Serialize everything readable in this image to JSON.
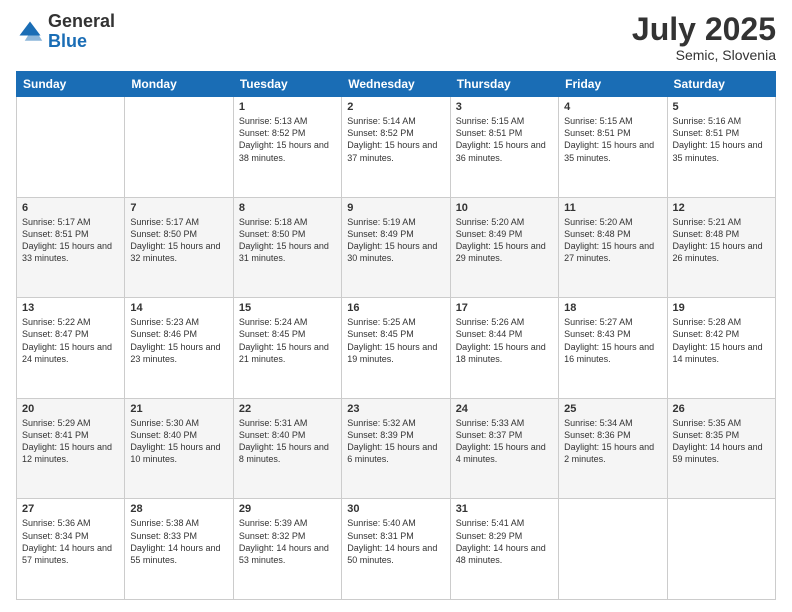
{
  "header": {
    "logo_general": "General",
    "logo_blue": "Blue",
    "title": "July 2025",
    "location": "Semic, Slovenia"
  },
  "days_of_week": [
    "Sunday",
    "Monday",
    "Tuesday",
    "Wednesday",
    "Thursday",
    "Friday",
    "Saturday"
  ],
  "weeks": [
    [
      {
        "day": "",
        "info": ""
      },
      {
        "day": "",
        "info": ""
      },
      {
        "day": "1",
        "info": "Sunrise: 5:13 AM\nSunset: 8:52 PM\nDaylight: 15 hours and 38 minutes."
      },
      {
        "day": "2",
        "info": "Sunrise: 5:14 AM\nSunset: 8:52 PM\nDaylight: 15 hours and 37 minutes."
      },
      {
        "day": "3",
        "info": "Sunrise: 5:15 AM\nSunset: 8:51 PM\nDaylight: 15 hours and 36 minutes."
      },
      {
        "day": "4",
        "info": "Sunrise: 5:15 AM\nSunset: 8:51 PM\nDaylight: 15 hours and 35 minutes."
      },
      {
        "day": "5",
        "info": "Sunrise: 5:16 AM\nSunset: 8:51 PM\nDaylight: 15 hours and 35 minutes."
      }
    ],
    [
      {
        "day": "6",
        "info": "Sunrise: 5:17 AM\nSunset: 8:51 PM\nDaylight: 15 hours and 33 minutes."
      },
      {
        "day": "7",
        "info": "Sunrise: 5:17 AM\nSunset: 8:50 PM\nDaylight: 15 hours and 32 minutes."
      },
      {
        "day": "8",
        "info": "Sunrise: 5:18 AM\nSunset: 8:50 PM\nDaylight: 15 hours and 31 minutes."
      },
      {
        "day": "9",
        "info": "Sunrise: 5:19 AM\nSunset: 8:49 PM\nDaylight: 15 hours and 30 minutes."
      },
      {
        "day": "10",
        "info": "Sunrise: 5:20 AM\nSunset: 8:49 PM\nDaylight: 15 hours and 29 minutes."
      },
      {
        "day": "11",
        "info": "Sunrise: 5:20 AM\nSunset: 8:48 PM\nDaylight: 15 hours and 27 minutes."
      },
      {
        "day": "12",
        "info": "Sunrise: 5:21 AM\nSunset: 8:48 PM\nDaylight: 15 hours and 26 minutes."
      }
    ],
    [
      {
        "day": "13",
        "info": "Sunrise: 5:22 AM\nSunset: 8:47 PM\nDaylight: 15 hours and 24 minutes."
      },
      {
        "day": "14",
        "info": "Sunrise: 5:23 AM\nSunset: 8:46 PM\nDaylight: 15 hours and 23 minutes."
      },
      {
        "day": "15",
        "info": "Sunrise: 5:24 AM\nSunset: 8:45 PM\nDaylight: 15 hours and 21 minutes."
      },
      {
        "day": "16",
        "info": "Sunrise: 5:25 AM\nSunset: 8:45 PM\nDaylight: 15 hours and 19 minutes."
      },
      {
        "day": "17",
        "info": "Sunrise: 5:26 AM\nSunset: 8:44 PM\nDaylight: 15 hours and 18 minutes."
      },
      {
        "day": "18",
        "info": "Sunrise: 5:27 AM\nSunset: 8:43 PM\nDaylight: 15 hours and 16 minutes."
      },
      {
        "day": "19",
        "info": "Sunrise: 5:28 AM\nSunset: 8:42 PM\nDaylight: 15 hours and 14 minutes."
      }
    ],
    [
      {
        "day": "20",
        "info": "Sunrise: 5:29 AM\nSunset: 8:41 PM\nDaylight: 15 hours and 12 minutes."
      },
      {
        "day": "21",
        "info": "Sunrise: 5:30 AM\nSunset: 8:40 PM\nDaylight: 15 hours and 10 minutes."
      },
      {
        "day": "22",
        "info": "Sunrise: 5:31 AM\nSunset: 8:40 PM\nDaylight: 15 hours and 8 minutes."
      },
      {
        "day": "23",
        "info": "Sunrise: 5:32 AM\nSunset: 8:39 PM\nDaylight: 15 hours and 6 minutes."
      },
      {
        "day": "24",
        "info": "Sunrise: 5:33 AM\nSunset: 8:37 PM\nDaylight: 15 hours and 4 minutes."
      },
      {
        "day": "25",
        "info": "Sunrise: 5:34 AM\nSunset: 8:36 PM\nDaylight: 15 hours and 2 minutes."
      },
      {
        "day": "26",
        "info": "Sunrise: 5:35 AM\nSunset: 8:35 PM\nDaylight: 14 hours and 59 minutes."
      }
    ],
    [
      {
        "day": "27",
        "info": "Sunrise: 5:36 AM\nSunset: 8:34 PM\nDaylight: 14 hours and 57 minutes."
      },
      {
        "day": "28",
        "info": "Sunrise: 5:38 AM\nSunset: 8:33 PM\nDaylight: 14 hours and 55 minutes."
      },
      {
        "day": "29",
        "info": "Sunrise: 5:39 AM\nSunset: 8:32 PM\nDaylight: 14 hours and 53 minutes."
      },
      {
        "day": "30",
        "info": "Sunrise: 5:40 AM\nSunset: 8:31 PM\nDaylight: 14 hours and 50 minutes."
      },
      {
        "day": "31",
        "info": "Sunrise: 5:41 AM\nSunset: 8:29 PM\nDaylight: 14 hours and 48 minutes."
      },
      {
        "day": "",
        "info": ""
      },
      {
        "day": "",
        "info": ""
      }
    ]
  ]
}
